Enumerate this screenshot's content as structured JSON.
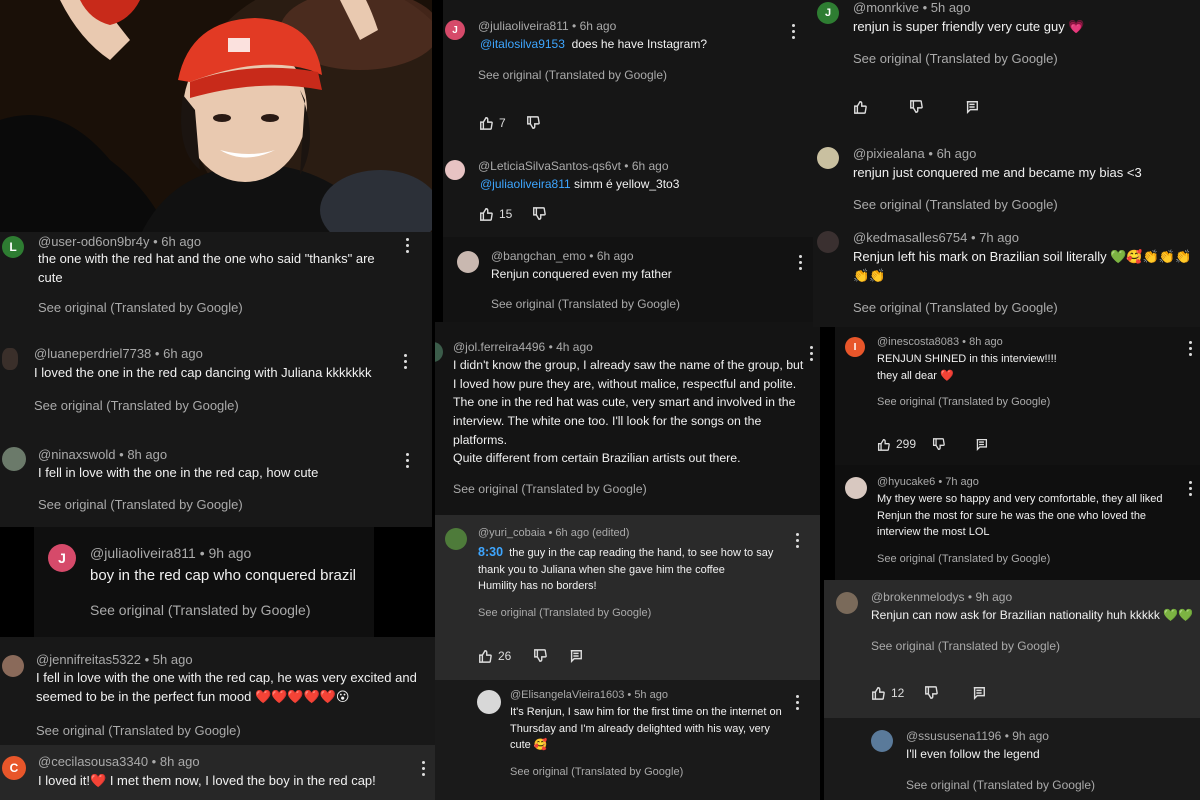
{
  "colors": {
    "mention": "#3ea6ff",
    "heart": "#e02424",
    "green_heart": "#3bb34a"
  },
  "emoji": {
    "pink_heart": "💗",
    "green_heart": "💚",
    "smiling_hearts": "🥰",
    "clap": "👏",
    "red_heart": "❤️",
    "hushed": "😮"
  },
  "labels": {
    "see_original": "See original (Translated by Google)",
    "dot": "•"
  },
  "col1": [
    {
      "avatar": "L",
      "avatar_color": "#2e7d32",
      "user": "@user-od6on9br4y",
      "time": "6h ago",
      "text": "the one with the red hat and the one who said \"thanks\" are cute"
    },
    {
      "avatar": "",
      "avatar_color": "#3a2f2a",
      "user": "@luaneperdriel7738",
      "time": "6h ago",
      "text": "I loved the one in the red cap dancing with Juliana kkkkkkk"
    },
    {
      "avatar": "",
      "avatar_color": "#6b7a6a",
      "user": "@ninaxswold",
      "time": "8h ago",
      "text": "I fell in love with the one in the red cap, how cute"
    },
    {
      "avatar": "J",
      "avatar_color": "#d64a6a",
      "user": "@juliaoliveira811",
      "time": "9h ago",
      "text": "boy in the red cap who conquered brazil"
    },
    {
      "avatar": "",
      "avatar_color": "#8a6a5a",
      "user": "@jennifreitas5322",
      "time": "5h ago",
      "text": "I fell in love with the one with the red cap, he was very excited and seemed to be in the perfect fun mood"
    },
    {
      "avatar": "C",
      "avatar_color": "#e8562a",
      "user": "@cecilasousa3340",
      "time": "8h ago",
      "text_a": "I loved it!",
      "text_b": " I met them now, I loved the boy in the red cap!"
    }
  ],
  "col2": [
    {
      "avatar": "J",
      "avatar_color": "#d64a6a",
      "user": "@juliaoliveira811",
      "time": "6h ago",
      "mention": "@italosilva9153",
      "text": "does he have Instagram?",
      "likes": "7"
    },
    {
      "avatar": "",
      "avatar_color": "#e7c3c3",
      "user": "@LeticiaSilvaSantos-qs6vt",
      "time": "6h ago",
      "mention": "@juliaoliveira811",
      "text": "simm é yellow_3to3",
      "likes": "15"
    },
    {
      "avatar": "",
      "avatar_color": "#c9b8b0",
      "user": "@bangchan_emo",
      "time": "6h ago",
      "text": "Renjun conquered even my father"
    },
    {
      "avatar": "",
      "avatar_color": "#3b5c4a",
      "user": "@jol.ferreira4496",
      "time": "4h ago",
      "text": "I didn't know the group, I already saw the name of the group, but I loved how pure they are, without malice, respectful and polite. The one in the red hat was cute, very smart and involved in the interview. The white one too. I'll look for the songs on the platforms.",
      "text2": "Quite different from certain Brazilian artists out there."
    },
    {
      "avatar": "",
      "avatar_color": "#4e7b3a",
      "user": "@yuri_cobaia",
      "time": "6h ago (edited)",
      "timestamp": "8:30",
      "text": "the guy in the cap reading the hand, to see how to say thank you to Juliana when she gave him the coffee",
      "text2": "Humility has no borders!",
      "likes": "26"
    },
    {
      "avatar": "",
      "avatar_color": "#d8d8d8",
      "user": "@ElisangelaVieira1603",
      "time": "5h ago",
      "text": "It's Renjun, I saw him for the first time on the internet on Thursday and I'm already delighted with his way, very cute"
    }
  ],
  "col3": [
    {
      "avatar": "J",
      "avatar_color": "#2e7d32",
      "user": "@monrkive",
      "time": "5h ago",
      "text": "renjun is super friendly very cute guy"
    },
    {
      "avatar": "",
      "avatar_color": "#c9c0a0",
      "user": "@pixiealana",
      "time": "6h ago",
      "text": "renjun just conquered me and became my bias <3"
    },
    {
      "avatar": "",
      "avatar_color": "#3a3030",
      "user": "@kedmasalles6754",
      "time": "7h ago",
      "text": "Renjun left his mark on Brazilian soil literally"
    },
    {
      "avatar": "I",
      "avatar_color": "#e8562a",
      "user": "@inescosta8083",
      "time": "8h ago",
      "text": "RENJUN SHINED in this interview!!!!",
      "text2": "they all dear",
      "likes": "299"
    },
    {
      "avatar": "",
      "avatar_color": "#d8c8c0",
      "user": "@hyucake6",
      "time": "7h ago",
      "text": "My they were so happy and very comfortable, they all liked Renjun the most for sure he was the one who loved the interview the most LOL"
    },
    {
      "avatar": "",
      "avatar_color": "#7a6a5a",
      "user": "@brokenmelodys",
      "time": "9h ago",
      "text": "Renjun can now ask for Brazilian nationality huh kkkkk",
      "likes": "12"
    },
    {
      "avatar": "",
      "avatar_color": "#5a7a9a",
      "user": "@ssususena1196",
      "time": "9h ago",
      "text": "I'll even follow the legend"
    }
  ]
}
